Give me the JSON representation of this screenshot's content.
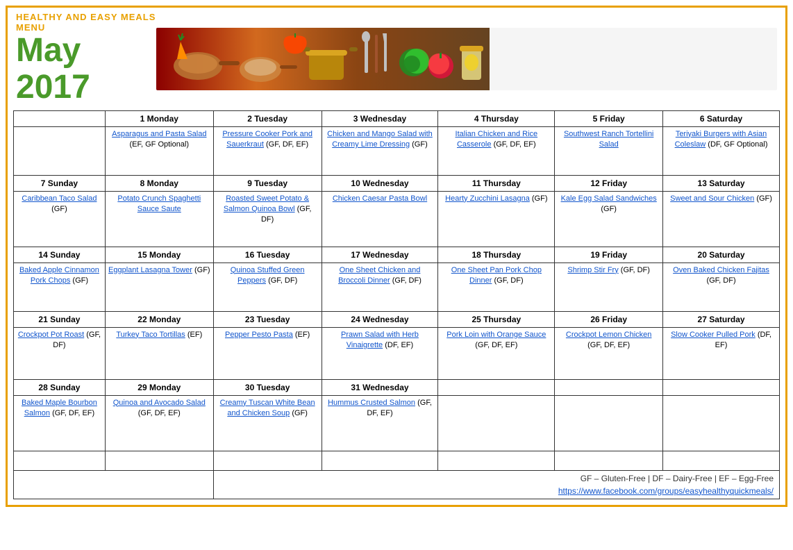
{
  "header": {
    "subtitle": "Healthy and Easy Meals Menu",
    "title": "May 2017"
  },
  "calendar": {
    "columns": [
      "",
      "1 Monday",
      "2 Tuesday",
      "3 Wednesday",
      "4 Thursday",
      "5 Friday",
      "6 Saturday"
    ],
    "rows": [
      {
        "cells": [
          {
            "day": "",
            "content": ""
          },
          {
            "day": "1 Monday",
            "link": "Asparagus and Pasta Salad",
            "extra": " (EF, GF Optional)"
          },
          {
            "day": "2 Tuesday",
            "link": "Pressure Cooker Pork and Sauerkraut",
            "extra": " (GF, DF, EF)"
          },
          {
            "day": "3 Wednesday",
            "link": "Chicken and Mango Salad with Creamy Lime Dressing",
            "extra": " (GF)"
          },
          {
            "day": "4 Thursday",
            "link": "Italian Chicken and Rice Casserole",
            "extra": " (GF, DF, EF)"
          },
          {
            "day": "5 Friday",
            "link": "Southwest Ranch Tortellini Salad",
            "extra": ""
          },
          {
            "day": "6 Saturday",
            "link": "Teriyaki Burgers with Asian Coleslaw",
            "extra": " (DF, GF Optional)"
          }
        ]
      },
      {
        "cells": [
          {
            "day": "7 Sunday",
            "link": "Caribbean Taco Salad",
            "extra": " (GF)"
          },
          {
            "day": "8 Monday",
            "link": "Potato Crunch Spaghetti Sauce Saute",
            "extra": ""
          },
          {
            "day": "9 Tuesday",
            "link": "Roasted Sweet Potato & Salmon Quinoa Bowl",
            "extra": " (GF, DF)"
          },
          {
            "day": "10 Wednesday",
            "link": "Chicken Caesar Pasta Bowl",
            "extra": ""
          },
          {
            "day": "11 Thursday",
            "link": "Hearty Zucchini Lasagna",
            "extra": " (GF)"
          },
          {
            "day": "12 Friday",
            "link": "Kale Egg Salad Sandwiches",
            "extra": " (GF)"
          },
          {
            "day": "13 Saturday",
            "link": "Sweet and Sour Chicken",
            "extra": " (GF)"
          }
        ]
      },
      {
        "cells": [
          {
            "day": "14 Sunday",
            "link": "Baked Apple Cinnamon Pork Chops",
            "extra": " (GF)"
          },
          {
            "day": "15 Monday",
            "link": "Eggplant Lasagna Tower",
            "extra": "(GF)"
          },
          {
            "day": "16 Tuesday",
            "link": "Quinoa Stuffed Green Peppers",
            "extra": " (GF, DF)"
          },
          {
            "day": "17 Wednesday",
            "link": "One Sheet Chicken and Broccoli Dinner",
            "extra": " (GF, DF)"
          },
          {
            "day": "18 Thursday",
            "link": "One Sheet Pan Pork Chop Dinner",
            "extra": " (GF, DF)"
          },
          {
            "day": "19 Friday",
            "link": "Shrimp Stir Fry",
            "extra": " (GF, DF)"
          },
          {
            "day": "20 Saturday",
            "link": "Oven Baked Chicken Fajitas",
            "extra": " (GF, DF)"
          }
        ]
      },
      {
        "cells": [
          {
            "day": "21 Sunday",
            "link": "Crockpot Pot Roast",
            "extra": " (GF, DF)"
          },
          {
            "day": "22 Monday",
            "link": "Turkey Taco Tortillas",
            "extra": " (EF)"
          },
          {
            "day": "23 Tuesday",
            "link": "Pepper Pesto Pasta",
            "extra": " (EF)"
          },
          {
            "day": "24 Wednesday",
            "link": "Prawn Salad with Herb Vinaigrette",
            "extra": " (DF, EF)"
          },
          {
            "day": "25 Thursday",
            "link": "Pork Loin with Orange Sauce",
            "extra": " (GF, DF, EF)"
          },
          {
            "day": "26 Friday",
            "link": "Crockpot Lemon Chicken",
            "extra": " (GF, DF, EF)"
          },
          {
            "day": "27 Saturday",
            "link": "Slow Cooker Pulled Pork",
            "extra": " (DF, EF)"
          }
        ]
      },
      {
        "cells": [
          {
            "day": "28 Sunday",
            "link": "Baked Maple Bourbon Salmon",
            "extra": " (GF, DF, EF)"
          },
          {
            "day": "29 Monday",
            "link": "Quinoa and Avocado Salad",
            "extra": " (GF, DF, EF)"
          },
          {
            "day": "30 Tuesday",
            "link": "Creamy Tuscan White Bean and Chicken Soup",
            "extra": " (GF)"
          },
          {
            "day": "31 Wednesday",
            "link": "Hummus Crusted Salmon",
            "extra": " (GF, DF, EF)"
          },
          {
            "day": "",
            "content": ""
          },
          {
            "day": "",
            "content": ""
          },
          {
            "day": "",
            "content": ""
          }
        ]
      }
    ],
    "legend": "GF – Gluten-Free  |  DF – Dairy-Free  |  EF – Egg-Free",
    "url": "https://www.facebook.com/groups/easyhealthyquickmeals/"
  }
}
